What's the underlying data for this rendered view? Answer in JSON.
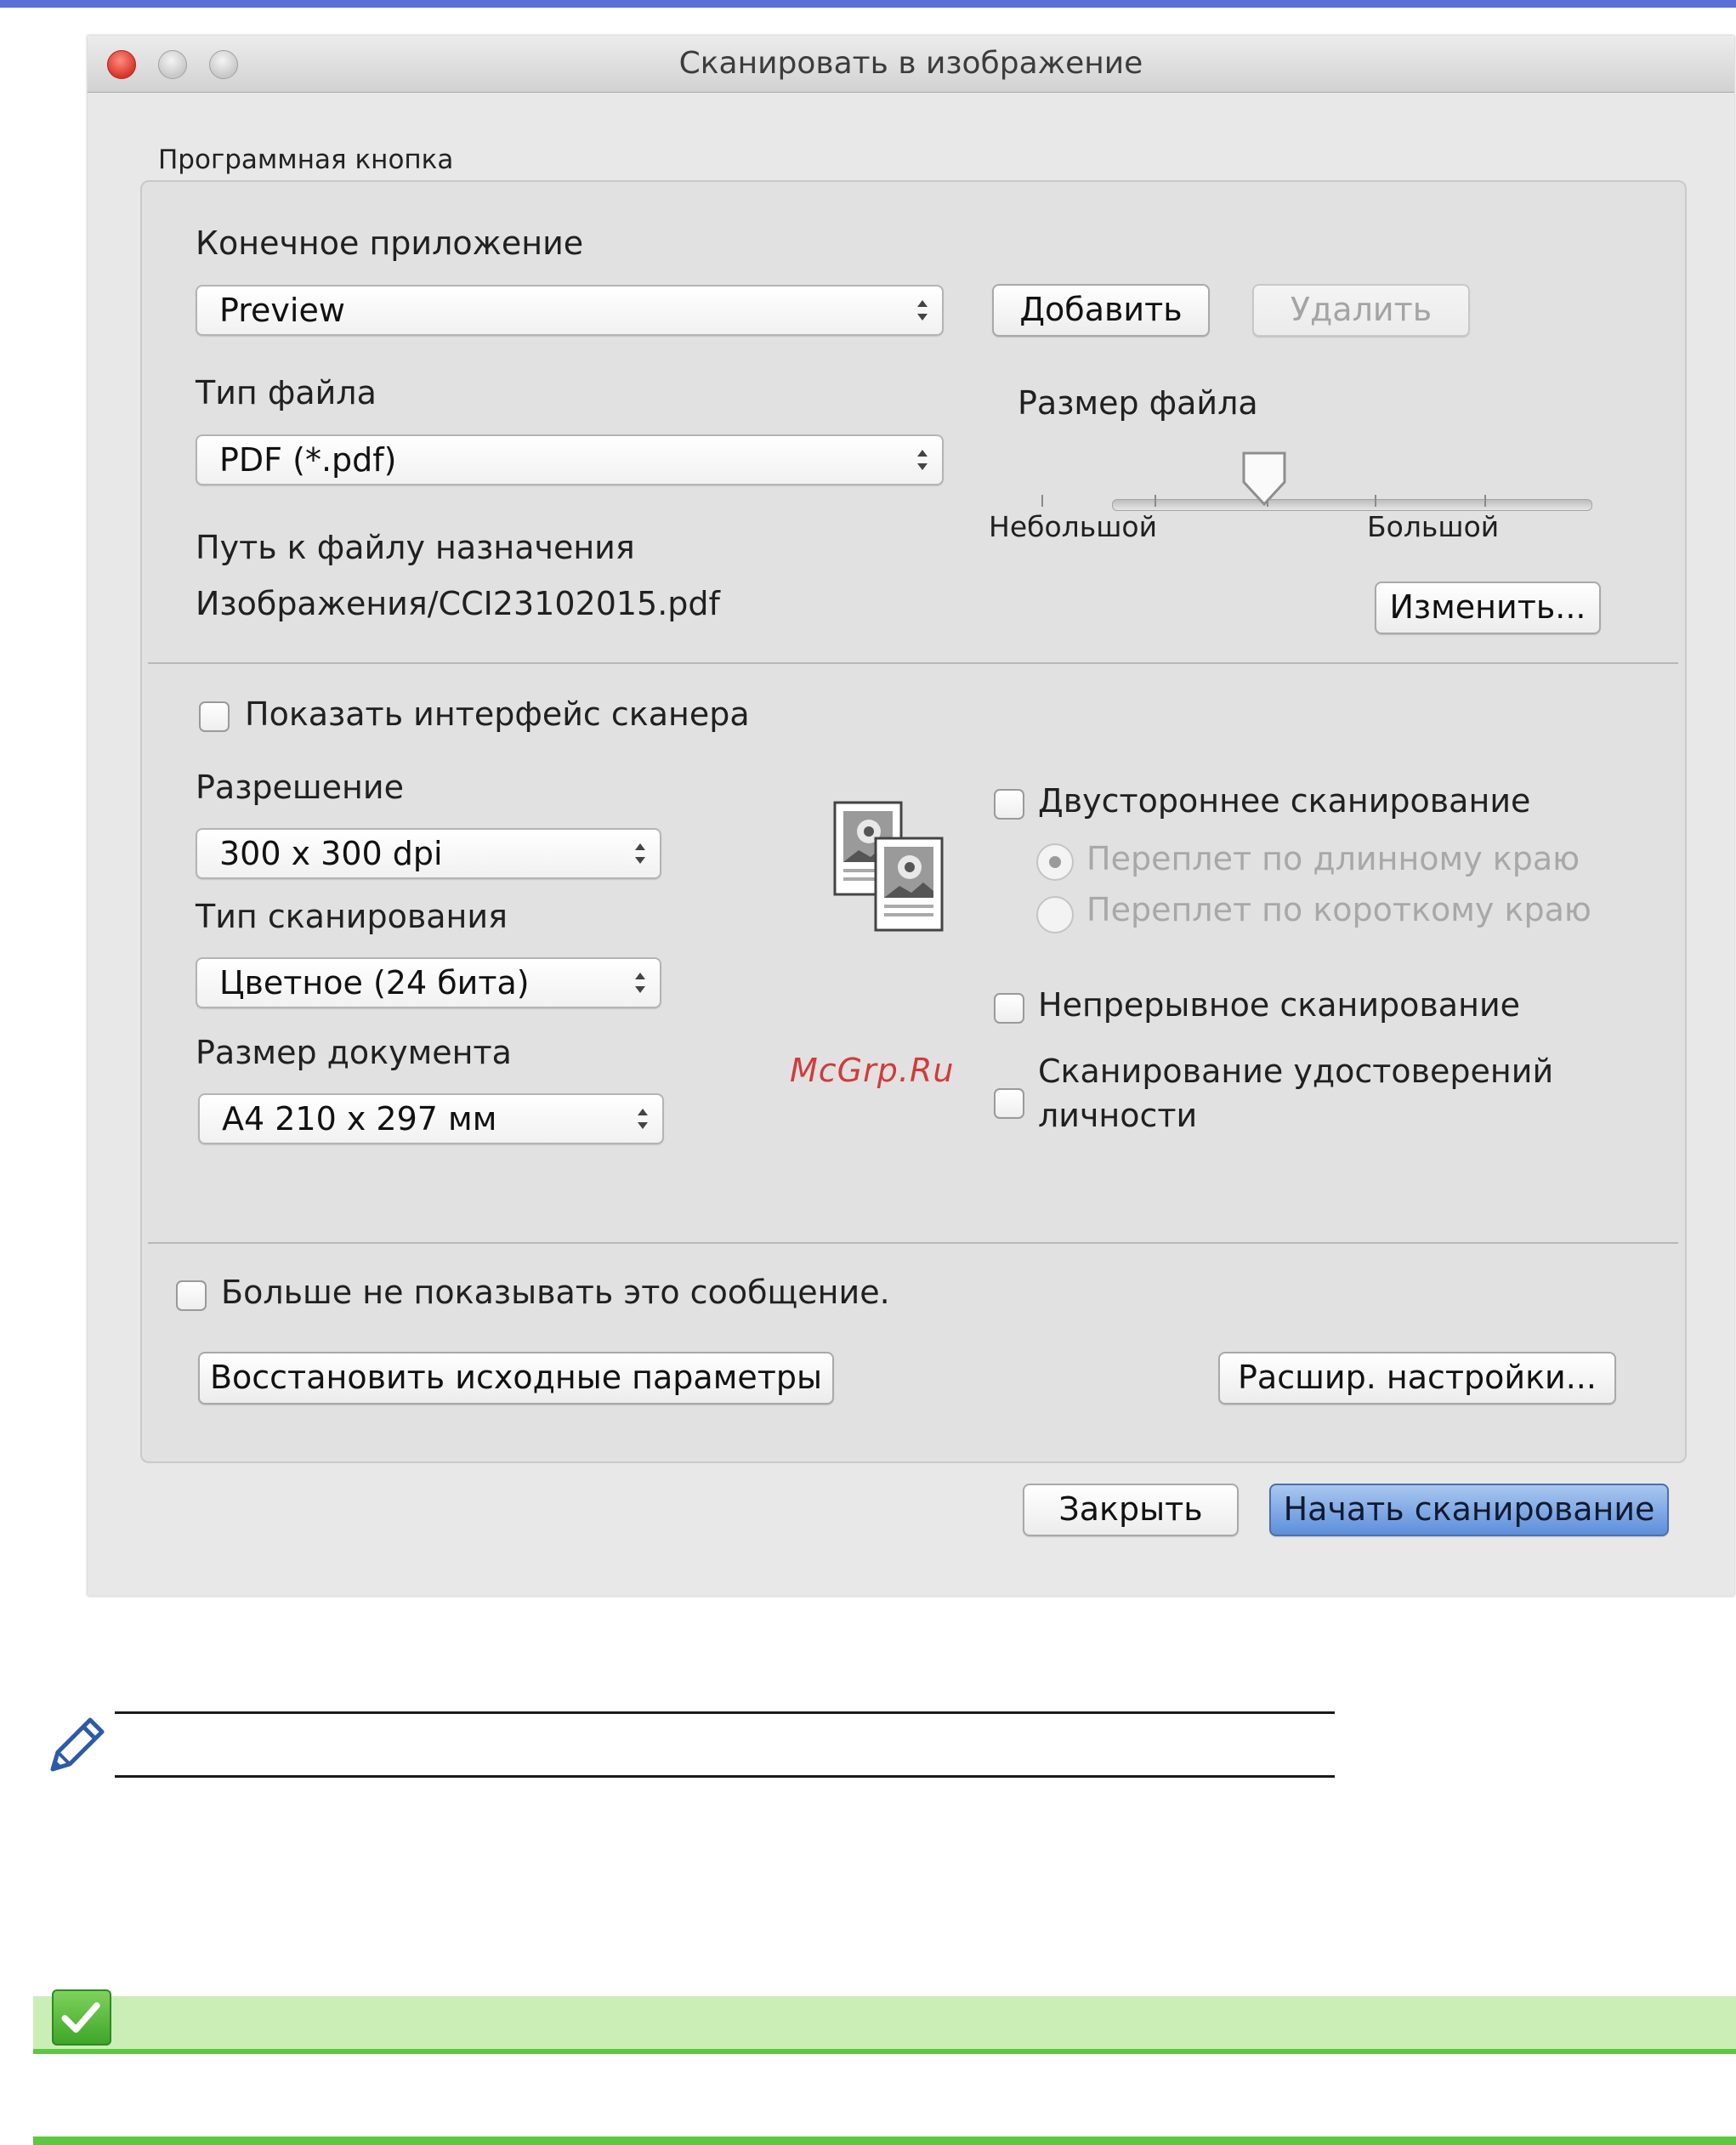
{
  "window": {
    "title": "Сканировать в изображение",
    "group_label": "Программная кнопка"
  },
  "target_app": {
    "label": "Конечное приложение",
    "value": "Preview",
    "add_button": "Добавить",
    "delete_button": "Удалить"
  },
  "file_type": {
    "label": "Тип файла",
    "value": "PDF (*.pdf)"
  },
  "file_size": {
    "label": "Размер файла",
    "min_label": "Небольшой",
    "max_label": "Большой",
    "level": 0.5
  },
  "destination": {
    "label": "Путь к файлу назначения",
    "path": "Изображения/CCI23102015.pdf",
    "change_button": "Изменить..."
  },
  "show_scanner_interface": {
    "label": "Показать интерфейс сканера",
    "checked": false
  },
  "resolution": {
    "label": "Разрешение",
    "value": "300 x 300  dpi"
  },
  "scan_type": {
    "label": "Тип сканирования",
    "value": "Цветное (24 бита)"
  },
  "document_size": {
    "label": "Размер документа",
    "value": "A4 210 x 297 мм"
  },
  "duplex": {
    "label": "Двустороннее сканирование",
    "checked": false,
    "long_edge": "Переплет по длинному краю",
    "short_edge": "Переплет по короткому краю"
  },
  "continuous": {
    "label": "Непрерывное сканирование",
    "checked": false
  },
  "id_card": {
    "label_line1": "Сканирование удостоверений",
    "label_line2": "личности",
    "checked": false
  },
  "dont_show": {
    "label": "Больше не показывать это сообщение.",
    "checked": false
  },
  "buttons": {
    "restore": "Восстановить исходные параметры",
    "advanced": "Расшир. настройки...",
    "close": "Закрыть",
    "start": "Начать сканирование"
  },
  "watermark": "McGrp.Ru",
  "colors": {
    "top_bar": "#5b6fd6",
    "primary_button": "#5d8fda",
    "green_bar": "#cbeeb7",
    "green_line": "#5cc83f",
    "watermark": "#d23b3b"
  }
}
